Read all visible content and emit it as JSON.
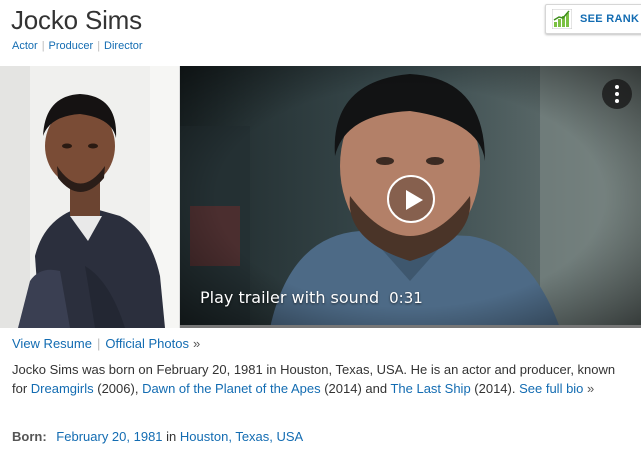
{
  "person": {
    "name": "Jocko Sims",
    "roles": [
      "Actor",
      "Producer",
      "Director"
    ]
  },
  "rank_button": {
    "label": "SEE RANK",
    "icon": "trending-chart-icon",
    "accent": "#7bc142"
  },
  "video": {
    "trailer_label": "Play trailer with sound",
    "duration": "0:31",
    "menu_icon": "more-vertical-icon",
    "play_icon": "play-icon"
  },
  "links": {
    "resume": "View Resume",
    "photos": "Official Photos",
    "raquo": "»"
  },
  "bio": {
    "text_1": "Jocko Sims was born on February 20, 1981 in Houston, Texas, USA. He is an actor and producer, known for ",
    "film_1": "Dreamgirls",
    "year_1": " (2006), ",
    "film_2": "Dawn of the Planet of the Apes",
    "year_2": " (2014) and ",
    "film_3": "The Last Ship",
    "year_3": " (2014). ",
    "full_bio": "See full bio",
    "raquo": "»"
  },
  "born": {
    "label": "Born:",
    "date": "February 20, 1981",
    "in": "in",
    "place": "Houston, Texas, USA"
  },
  "colors": {
    "link": "#136cb2",
    "text": "#333333",
    "muted": "#999999"
  }
}
